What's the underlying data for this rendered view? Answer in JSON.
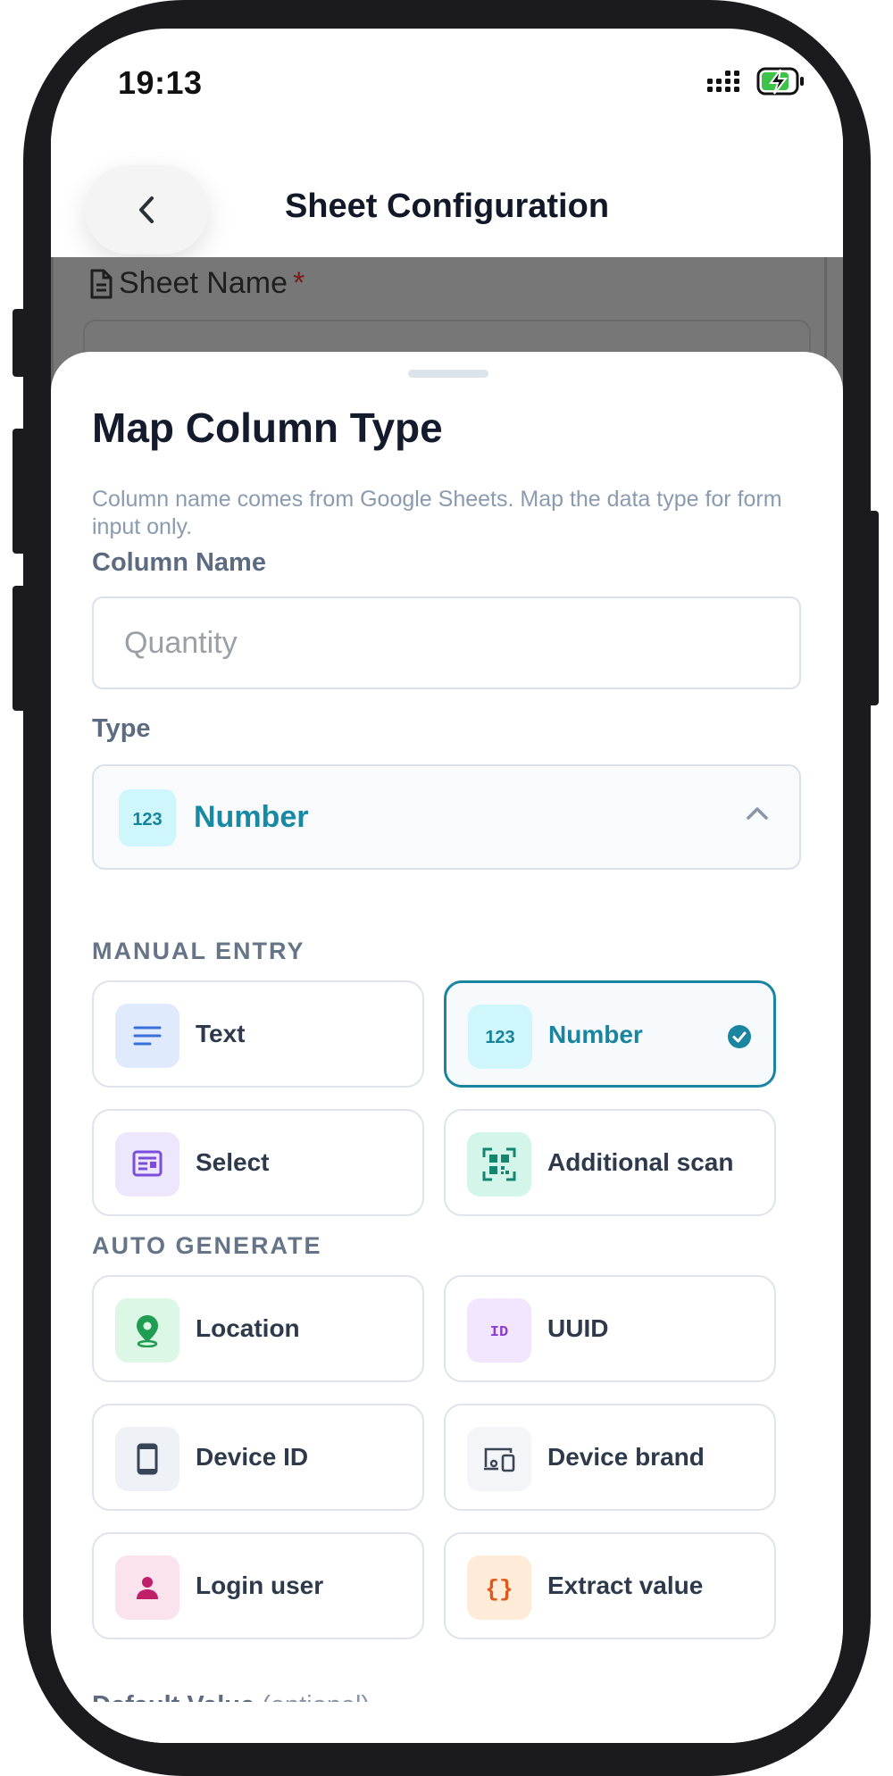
{
  "status_bar": {
    "time": "19:13"
  },
  "header": {
    "title": "Sheet Configuration"
  },
  "background_form": {
    "sheet_name_label": "Sheet Name",
    "required_mark": "*"
  },
  "sheet": {
    "title": "Map Column Type",
    "subtitle": "Column name comes from Google Sheets. Map the data type for form input only.",
    "column_name_label": "Column Name",
    "column_name_placeholder": "Quantity",
    "type_label": "Type",
    "selected_type": "Number",
    "sections": {
      "manual_entry": "MANUAL ENTRY",
      "auto_generate": "AUTO GENERATE"
    },
    "manual_types": [
      {
        "label": "Text",
        "icon": "text-lines-icon",
        "selected": false
      },
      {
        "label": "Number",
        "icon": "number-123-icon",
        "selected": true
      },
      {
        "label": "Select",
        "icon": "select-list-icon",
        "selected": false
      },
      {
        "label": "Additional scan",
        "icon": "qr-scan-icon",
        "selected": false
      }
    ],
    "auto_types": [
      {
        "label": "Location",
        "icon": "location-pin-icon"
      },
      {
        "label": "UUID",
        "icon": "id-badge-icon"
      },
      {
        "label": "Device ID",
        "icon": "smartphone-icon"
      },
      {
        "label": "Device brand",
        "icon": "devices-icon"
      },
      {
        "label": "Login user",
        "icon": "person-icon"
      },
      {
        "label": "Extract value",
        "icon": "braces-icon"
      }
    ],
    "default_value_label": "Default Value",
    "default_value_hint": "(optional)"
  },
  "colors": {
    "accent": "#1a85a0",
    "text_primary": "#141b2d",
    "muted": "#8a9bb0",
    "battery_green": "#3cc44a"
  }
}
